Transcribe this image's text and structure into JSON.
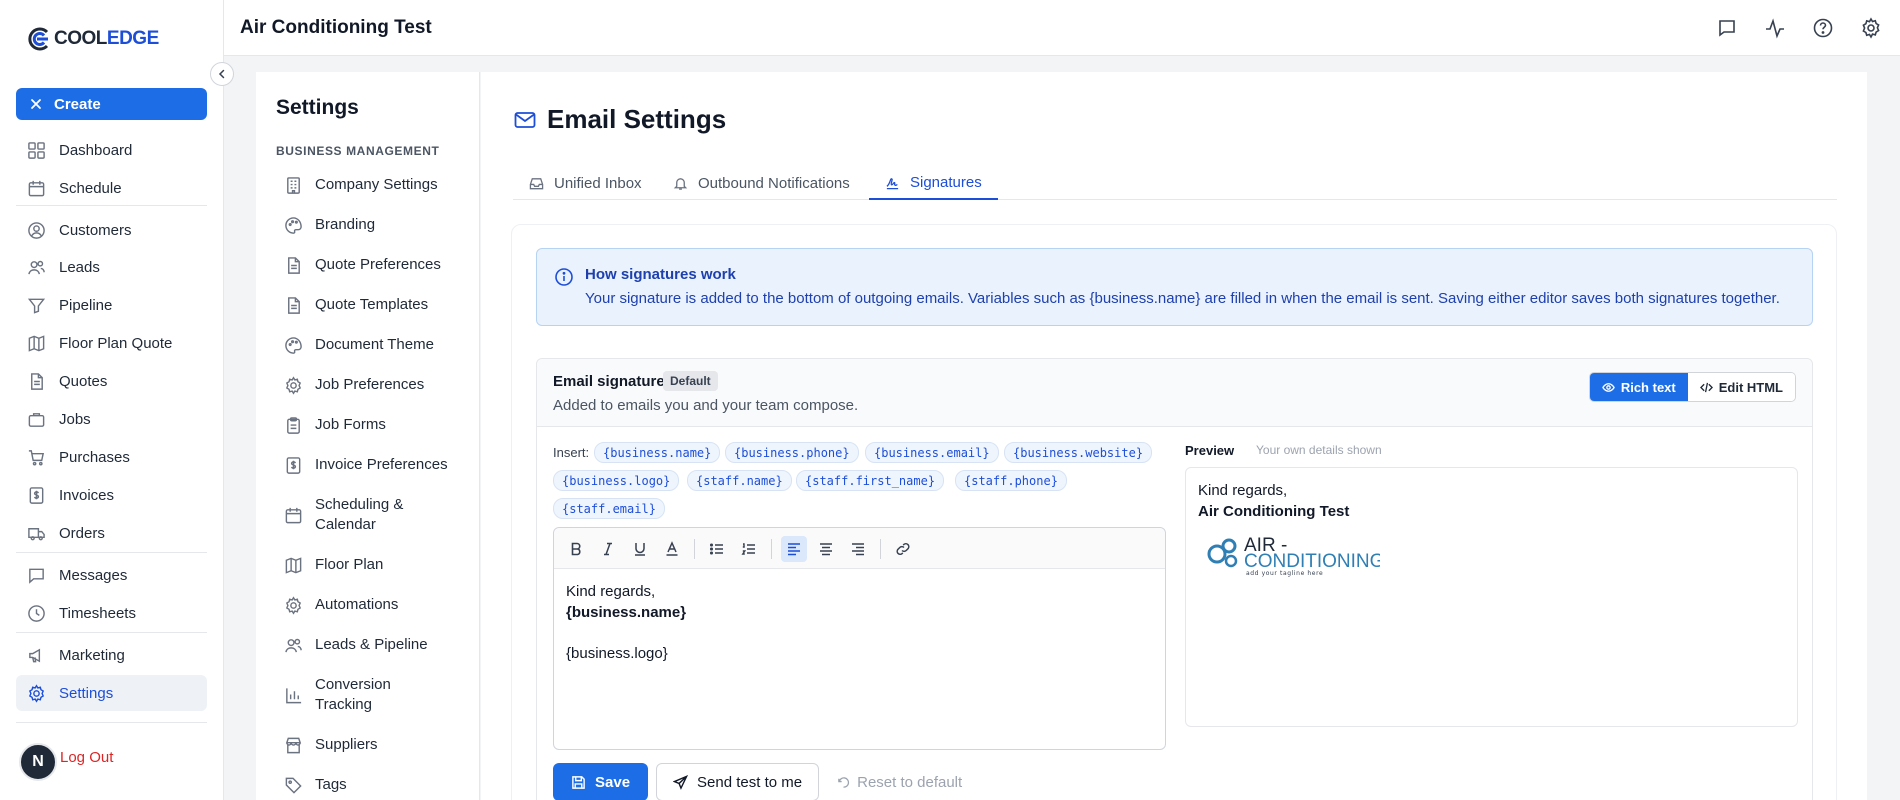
{
  "brand": {
    "name_part1": "COOL",
    "name_part2": "EDGE"
  },
  "header": {
    "title": "Air Conditioning Test"
  },
  "sidebar": {
    "create_label": "Create",
    "items": [
      {
        "label": "Dashboard",
        "icon": "dashboard-icon"
      },
      {
        "label": "Schedule",
        "icon": "calendar-icon"
      },
      {
        "label": "Customers",
        "icon": "user-circle-icon"
      },
      {
        "label": "Leads",
        "icon": "users-icon"
      },
      {
        "label": "Pipeline",
        "icon": "funnel-icon"
      },
      {
        "label": "Floor Plan Quote",
        "icon": "map-icon"
      },
      {
        "label": "Quotes",
        "icon": "document-icon"
      },
      {
        "label": "Jobs",
        "icon": "briefcase-icon"
      },
      {
        "label": "Purchases",
        "icon": "cart-icon"
      },
      {
        "label": "Invoices",
        "icon": "dollar-doc-icon"
      },
      {
        "label": "Orders",
        "icon": "truck-icon"
      },
      {
        "label": "Messages",
        "icon": "chat-icon"
      },
      {
        "label": "Timesheets",
        "icon": "clock-icon"
      },
      {
        "label": "Marketing",
        "icon": "megaphone-icon"
      },
      {
        "label": "Settings",
        "icon": "gear-icon",
        "active": true
      }
    ],
    "avatar_initial": "N",
    "logout_label": "Log Out"
  },
  "settings": {
    "title": "Settings",
    "section": "BUSINESS MANAGEMENT",
    "items": [
      {
        "label": "Company Settings"
      },
      {
        "label": "Branding"
      },
      {
        "label": "Quote Preferences"
      },
      {
        "label": "Quote Templates"
      },
      {
        "label": "Document Theme"
      },
      {
        "label": "Job Preferences"
      },
      {
        "label": "Job Forms"
      },
      {
        "label": "Invoice Preferences"
      },
      {
        "label": "Scheduling & Calendar"
      },
      {
        "label": "Floor Plan"
      },
      {
        "label": "Automations"
      },
      {
        "label": "Leads & Pipeline"
      },
      {
        "label": "Conversion Tracking"
      },
      {
        "label": "Suppliers"
      },
      {
        "label": "Tags"
      }
    ]
  },
  "page": {
    "title": "Email Settings",
    "tabs": [
      {
        "label": "Unified Inbox"
      },
      {
        "label": "Outbound Notifications"
      },
      {
        "label": "Signatures",
        "active": true
      }
    ]
  },
  "info": {
    "heading": "How signatures work",
    "text": "Your signature is added to the bottom of outgoing emails. Variables such as {business.name} are filled in when the email is sent. Saving either editor saves both signatures together."
  },
  "signature": {
    "title": "Email signature",
    "badge": "Default",
    "subtitle": "Added to emails you and your team compose.",
    "mode_rich": "Rich text",
    "mode_html": "Edit HTML",
    "insert_label": "Insert:",
    "variables": [
      "{business.name}",
      "{business.phone}",
      "{business.email}",
      "{business.website}",
      "{business.logo}",
      "{staff.name}",
      "{staff.first_name}",
      "{staff.phone}",
      "{staff.email}"
    ],
    "editor_lines": [
      "Kind regards,",
      "{business.name}",
      "",
      "{business.logo}"
    ],
    "preview_label": "Preview",
    "preview_hint": "Your own details shown",
    "preview_lines": [
      "Kind regards,",
      "Air Conditioning Test"
    ],
    "logo": {
      "line1": "AIR -",
      "line2": "CONDITIONING",
      "tagline": "add your tagline here"
    },
    "save_label": "Save",
    "test_label": "Send test to me",
    "reset_label": "Reset to default"
  },
  "colors": {
    "accent": "#1d6ee6",
    "link": "#1d4ed8",
    "info_bg": "#eaf3fd",
    "danger": "#dc2626"
  }
}
